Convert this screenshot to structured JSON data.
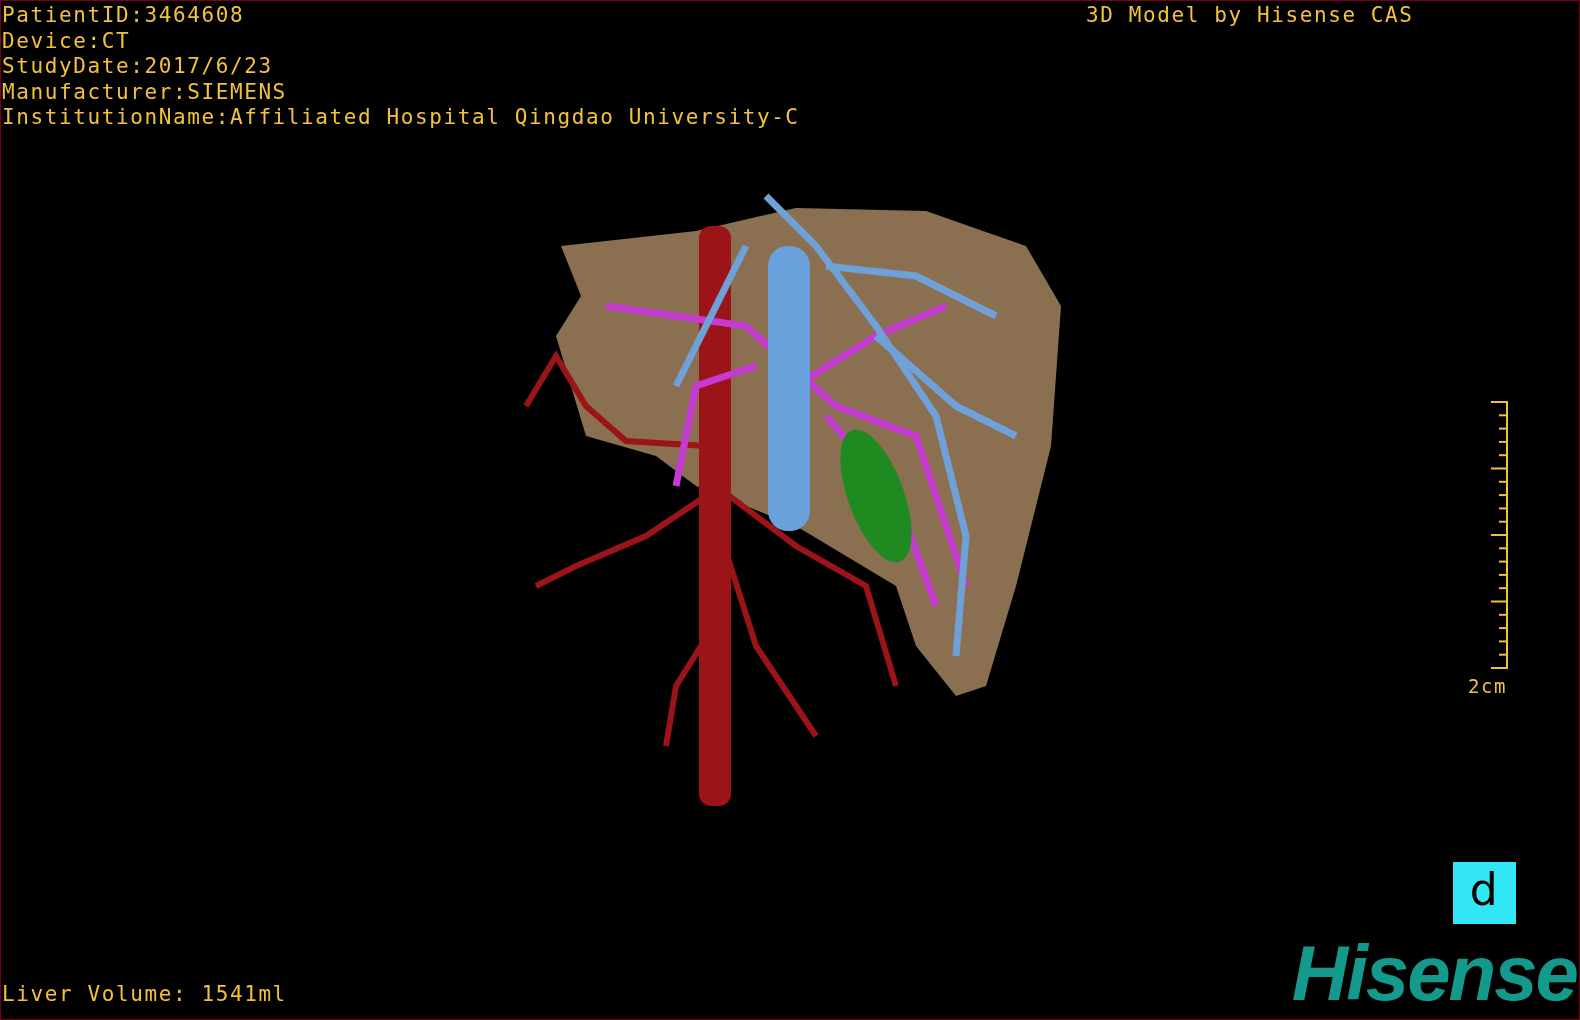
{
  "patient_info": [
    "PatientID:3464608",
    "Device:CT",
    "StudyDate:2017/6/23",
    "Manufacturer:SIEMENS",
    "InstitutionName:Affiliated Hospital Qingdao University-C"
  ],
  "model_credit": "3D Model by Hisense CAS",
  "scale_bar": {
    "label": "2cm"
  },
  "orientation_marker": "d",
  "liver_volume": "Liver Volume: 1541ml",
  "logo": "Hisense"
}
